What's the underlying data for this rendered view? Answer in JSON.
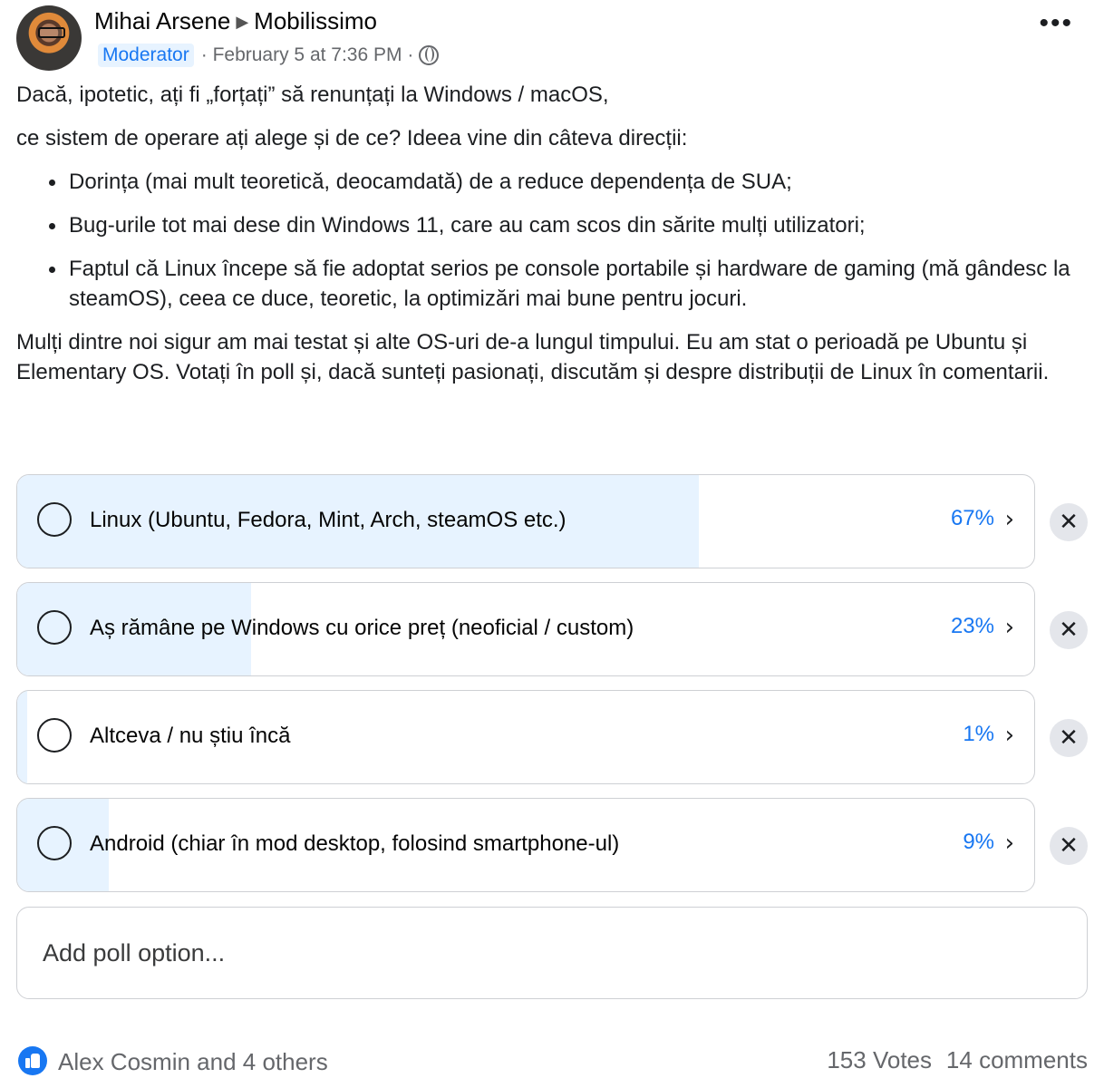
{
  "header": {
    "author": "Mihai Arsene",
    "group": "Mobilissimo",
    "badge": "Moderator",
    "timestamp": "February 5 at 7:36 PM",
    "separator": "·",
    "privacy_icon": "globe-icon",
    "more_icon": "more-options-icon"
  },
  "post": {
    "p1": "Dacă, ipotetic, ați fi „forțați” să renunțați la Windows / macOS,",
    "p2": "ce sistem de operare ați alege și de ce? Ideea vine din câteva direcții:",
    "bullets": [
      "Dorința (mai mult teoretică, deocamdată) de a reduce dependența de SUA;",
      "Bug-urile tot mai dese din Windows 11, care au cam scos din sărite mulți utilizatori;",
      "Faptul că Linux începe să fie adoptat serios pe console portabile și hardware de gaming (mă gândesc la steamOS), ceea ce duce, teoretic, la optimizări mai bune pentru jocuri."
    ],
    "p3": "Mulți dintre noi sigur am mai testat și alte OS-uri de-a lungul timpului. Eu am stat o perioadă pe Ubuntu și Elementary OS. Votați în poll și, dacă sunteți pasionați, discutăm și despre distribuții de Linux în comentarii."
  },
  "poll": {
    "options": [
      {
        "label": "Linux (Ubuntu, Fedora, Mint, Arch, steamOS etc.)",
        "percent_text": "67%",
        "percent": 67
      },
      {
        "label": "Aș rămâne pe Windows cu orice preț (neoficial / custom)",
        "percent_text": "23%",
        "percent": 23
      },
      {
        "label": "Altceva / nu știu încă",
        "percent_text": "1%",
        "percent": 1
      },
      {
        "label": "Android (chiar în mod desktop, folosind smartphone-ul)",
        "percent_text": "9%",
        "percent": 9
      }
    ],
    "chevron": "›",
    "remove_glyph": "✕",
    "add_placeholder": "Add poll option...",
    "fill_color": "#e7f3ff",
    "accent_color": "#1877f2"
  },
  "footer": {
    "likers": "Alex Cosmin and 4 others",
    "votes": "153 Votes",
    "comments": "14 comments"
  }
}
